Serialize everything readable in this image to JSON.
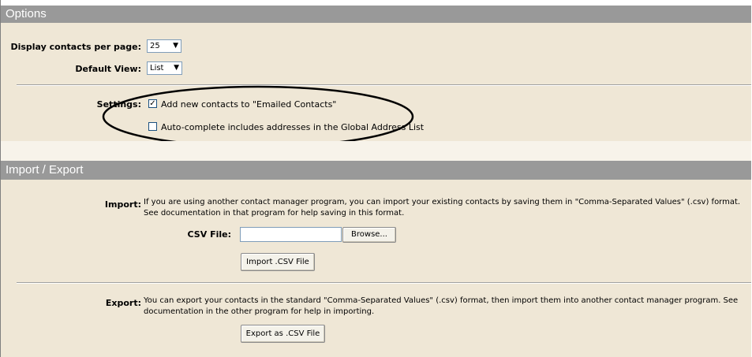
{
  "options": {
    "title": "Options",
    "per_page_label": "Display contacts per page:",
    "per_page_value": "25",
    "default_view_label": "Default View:",
    "default_view_value": "List",
    "settings_label": "Settings:",
    "setting_add_emailed": "Add new contacts to \"Emailed Contacts\"",
    "setting_autocomplete": "Auto-complete includes addresses in the Global Address List"
  },
  "import_export": {
    "title": "Import / Export",
    "import_label": "Import:",
    "import_desc_line1": "If you are using another contact manager program, you can import your existing contacts by saving them in \"Comma-Separated Values\" (.csv) format.",
    "import_desc_line2": "See documentation in that program for help saving in this format.",
    "csv_file_label": "CSV File:",
    "browse_label": "Browse...",
    "import_button": "Import .CSV File",
    "export_label": "Export:",
    "export_desc_line1": "You can export your contacts in the standard \"Comma-Separated Values\" (.csv) format, then import them into another contact manager program. See",
    "export_desc_line2": "documentation in the other program for help in importing.",
    "export_button": "Export as .CSV File"
  },
  "icons": {
    "dropdown": "chevron-down-icon",
    "checkmark": "checkmark-icon"
  }
}
